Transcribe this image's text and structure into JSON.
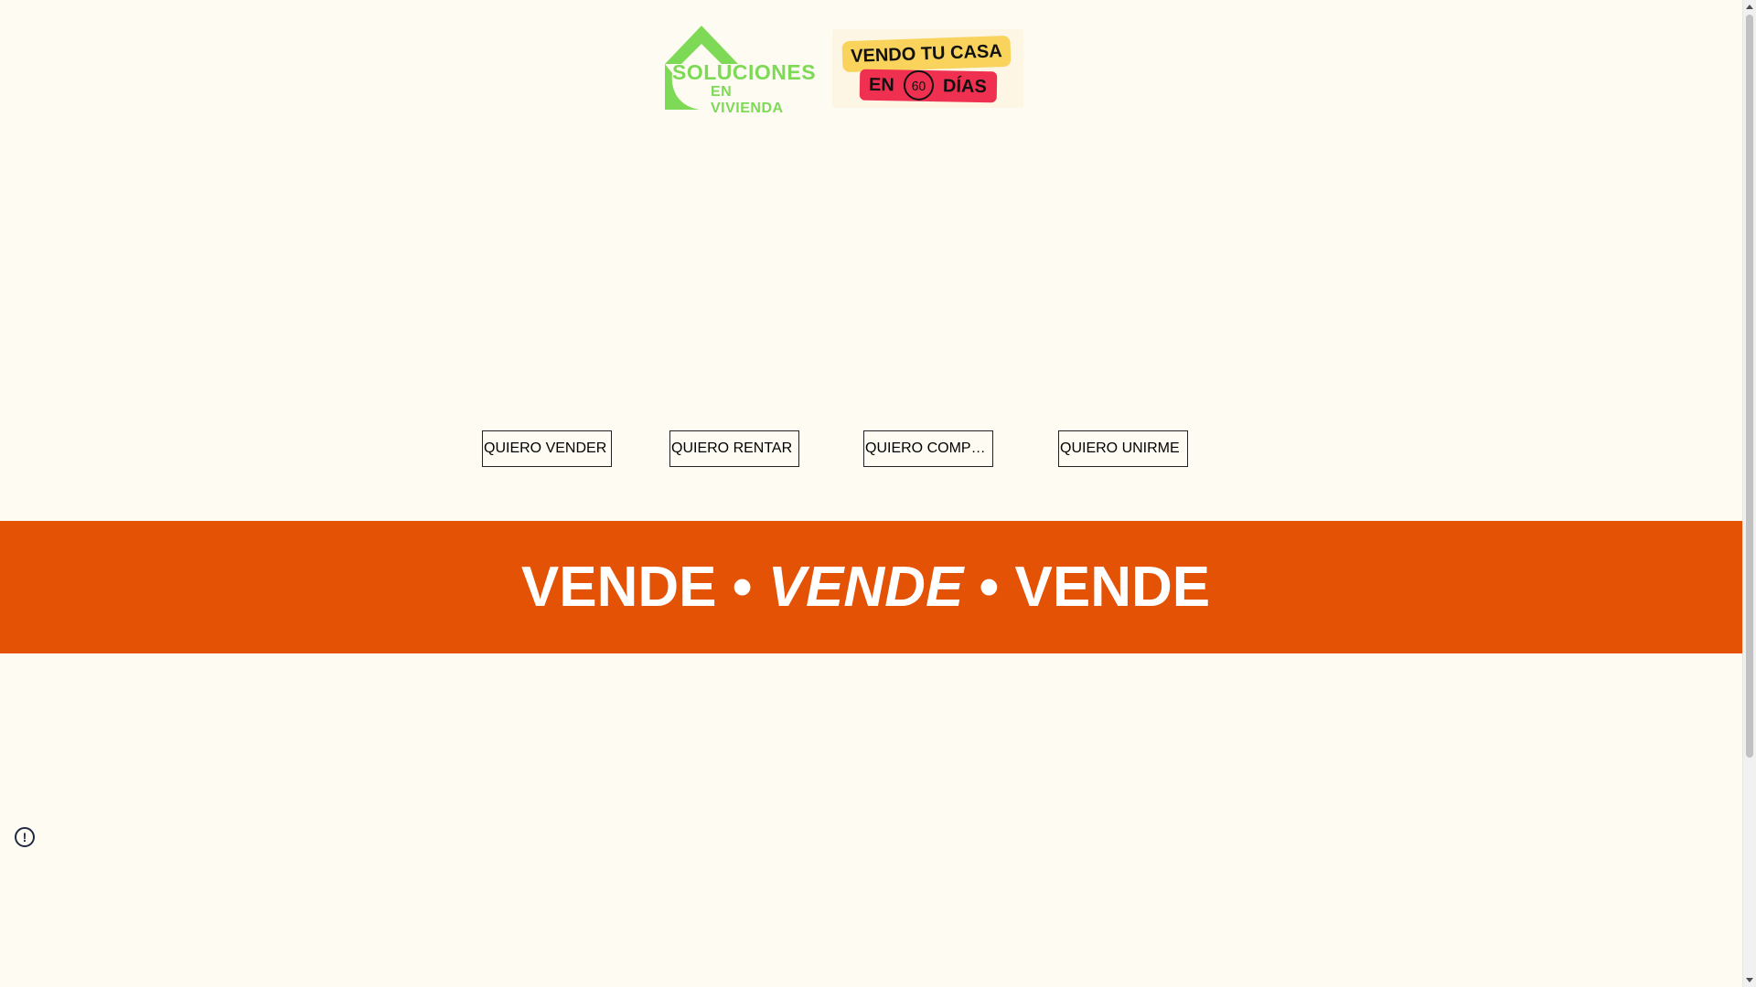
{
  "logo": {
    "line1": "SOLUCIONES",
    "line2": "EN VIVIENDA"
  },
  "badge": {
    "top": "VENDO TU CASA",
    "en": "EN",
    "number": "60",
    "dias": "DÍAS"
  },
  "nav": {
    "sell": "QUIERO VENDER",
    "rent": "QUIERO RENTAR",
    "buy": "QUIERO COMPRAR",
    "join": "QUIERO UNIRME"
  },
  "banner": {
    "word1": "VENDE",
    "sep1": "•",
    "word2": "VENDE",
    "sep2": "•",
    "word3": "VENDE"
  },
  "info": {
    "glyph": "!"
  },
  "colors": {
    "background": "#fefbf2",
    "banner": "#e35205",
    "logo_green": "#7ed957",
    "badge_yellow": "#f9d35b",
    "badge_red": "#ef3050"
  }
}
